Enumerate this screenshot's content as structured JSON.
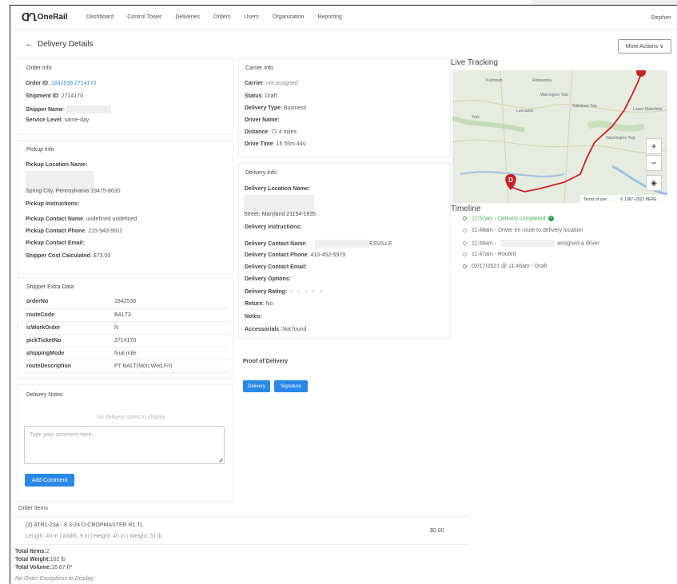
{
  "nav": {
    "logo_mark": "ᗡՂ",
    "logo_text": "OneRail",
    "items": [
      "Dashboard",
      "Control Tower",
      "Deliveries",
      "Orders",
      "Users",
      "Organization",
      "Reporting"
    ],
    "user": "Stephen"
  },
  "page": {
    "back": "←",
    "title": "Delivery Details",
    "more_actions": "More Actions ∨"
  },
  "order_info": {
    "title": "Order Info",
    "order_id_label": "Order ID",
    "order_id": "1842536.2714170",
    "shipment_label": "Shipment ID",
    "shipment": "2714170",
    "shipper_label": "Shipper Name",
    "service_label": "Service Level",
    "service": "same-day"
  },
  "pickup": {
    "title": "Pickup Info",
    "location_label": "Pickup Location Name:",
    "address": "Spring City, Pennsylvania 19475-8630",
    "instructions_label": "Pickup Instructions:",
    "contact_name_label": "Pickup Contact Name",
    "contact_name": "undefined undefined",
    "contact_phone_label": "Pickup Contact Phone",
    "contact_phone": "215-943-9911",
    "contact_email_label": "Pickup Contact Email:",
    "cost_label": "Shipper Cost Calculated",
    "cost": "$73.00"
  },
  "extra": {
    "title": "Shipper Extra Data",
    "rows": [
      {
        "k": "orderNo",
        "v": "1842536"
      },
      {
        "k": "routeCode",
        "v": "BALT3"
      },
      {
        "k": "isWorkOrder",
        "v": "N"
      },
      {
        "k": "pickTicketNo",
        "v": "2714170"
      },
      {
        "k": "shippingMode",
        "v": "final mile"
      },
      {
        "k": "routeDescription",
        "v": "PT BALT(Mon,Wed,Fri)"
      }
    ]
  },
  "notes": {
    "title": "Delivery Notes",
    "empty": "No delivery notes to display",
    "placeholder": "Type your comment here...",
    "add": "Add Comment"
  },
  "carrier": {
    "title": "Carrier Info",
    "carrier_label": "Carrier",
    "carrier": "not assigned",
    "status_label": "Status",
    "status": "Draft",
    "type_label": "Delivery Type",
    "type": "Business",
    "driver_label": "Driver Name:",
    "distance_label": "Distance",
    "distance": "72.4 miles",
    "drive_label": "Drive Time",
    "drive": "1h 55m 44s"
  },
  "delivery": {
    "title": "Delivery Info",
    "location_label": "Delivery Location Name:",
    "address": "Street, Maryland 21154-1635",
    "instructions_label": "Delivery Instructions:",
    "contact_name_label": "Delivery Contact Name",
    "contact_name_suffix": "ESVILLE",
    "contact_phone_label": "Delivery Contact Phone",
    "contact_phone": "410-452-5979",
    "contact_email_label": "Delivery Contact Email:",
    "options_label": "Delivery Options:",
    "rating_label": "Delivery Rating:",
    "stars": "★★★★★",
    "return_label": "Return",
    "return": "No",
    "notes_label": "Notes:",
    "accessorials_label": "Accessorials",
    "accessorials": "Not found"
  },
  "proof": {
    "title": "Proof of Delivery",
    "delivery_btn": "Delivery",
    "signature_btn": "Signature"
  },
  "tracking": {
    "title": "Live Tracking",
    "map_labels": [
      "Kutztown",
      "Robesonia",
      "Lancaster",
      "Salisbury Twp",
      "York",
      "Warrington Twp",
      "Lower Makefield",
      "Washington Twp"
    ],
    "marker": "D",
    "terms": "Terms of use",
    "copyright": "© 1987–2022 HERE"
  },
  "timeline": {
    "title": "Timeline",
    "items": [
      {
        "text": "11:52am - Delivery completed",
        "green": true
      },
      {
        "text": "11:48am - Driver en route to delivery location",
        "green": false
      },
      {
        "text": "11:48am -",
        "suffix": "assigned a driver",
        "green": false
      },
      {
        "text": "11:47am - Routed",
        "green": false
      },
      {
        "text": "02/17/2021 @ 11:46am - Draft",
        "green": true
      }
    ]
  },
  "order_items": {
    "title": "Order Items",
    "item": "(2) ATR1-23A - 8.3-24 D-CROPMASTER R1 TL",
    "dims": "Length: 40 in | Width: 9 in | Height: 40 in | Weight: 51 lb",
    "price": "$0.00",
    "total_items_label": "Total Items:",
    "total_items": "2",
    "total_weight_label": "Total Weight:",
    "total_weight": "102 lb",
    "total_volume_label": "Total Volume:",
    "total_volume": "16.67 ft³",
    "exceptions": "No Order Exceptions to Display"
  }
}
